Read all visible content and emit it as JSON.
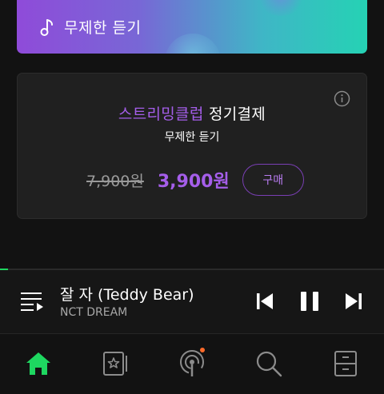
{
  "banner": {
    "label": "무제한 듣기",
    "icon": "music-note-icon"
  },
  "subscription_card": {
    "title_accent": "스트리밍클럽",
    "title_rest": " 정기결제",
    "subtitle": "무제한 듣기",
    "original_price": "7,900원",
    "sale_price": "3,900원",
    "buy_label": "구매",
    "accent_color": "#a55eea",
    "info_icon": "info-icon"
  },
  "player": {
    "progress_fraction": 0.02,
    "track_title": "잘 자 (Teddy Bear)",
    "artist": "NCT DREAM",
    "controls": [
      "skip-previous-icon",
      "pause-icon",
      "skip-next-icon"
    ],
    "queue_icon": "playlist-icon"
  },
  "bottom_nav": {
    "items": [
      {
        "id": "home",
        "icon": "home-icon",
        "active": true
      },
      {
        "id": "library",
        "icon": "library-icon",
        "active": false
      },
      {
        "id": "podcast",
        "icon": "podcast-icon",
        "active": false,
        "badge": true
      },
      {
        "id": "search",
        "icon": "search-icon",
        "active": false
      },
      {
        "id": "storage",
        "icon": "storage-icon",
        "active": false
      }
    ],
    "active_color": "#1ed760",
    "badge_color": "#ff6a2a"
  }
}
